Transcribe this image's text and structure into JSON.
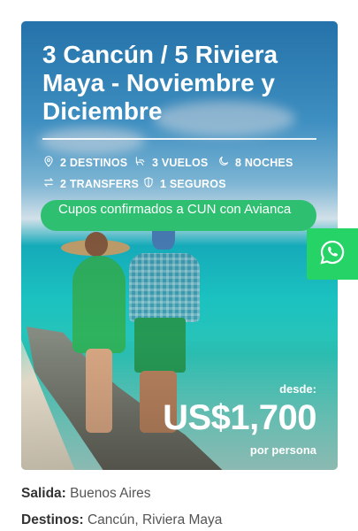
{
  "card": {
    "title": "3 Cancún / 5 Riviera Maya - Noviembre y Diciembre",
    "stats": [
      {
        "icon": "map-pin-icon",
        "label": "2 DESTINOS"
      },
      {
        "icon": "plane-seat-icon",
        "label": "3 VUELOS"
      },
      {
        "icon": "moon-icon",
        "label": "8 NOCHES"
      },
      {
        "icon": "transfer-arrows-icon",
        "label": "2 TRANSFERS"
      },
      {
        "icon": "shield-icon",
        "label": "1 SEGUROS"
      }
    ],
    "badge": "Cupos confirmados a CUN con Avianca",
    "price": {
      "from_label": "desde:",
      "amount": "US$1,700",
      "per_label": "por persona"
    }
  },
  "whatsapp": {
    "icon": "whatsapp-icon",
    "color": "#25d366"
  },
  "details": {
    "salida_label": "Salida:",
    "salida_value": "Buenos Aires",
    "destinos_label": "Destinos:",
    "destinos_value": "Cancún, Riviera Maya"
  },
  "colors": {
    "badge": "#2fbf71",
    "whatsapp": "#25d366"
  }
}
